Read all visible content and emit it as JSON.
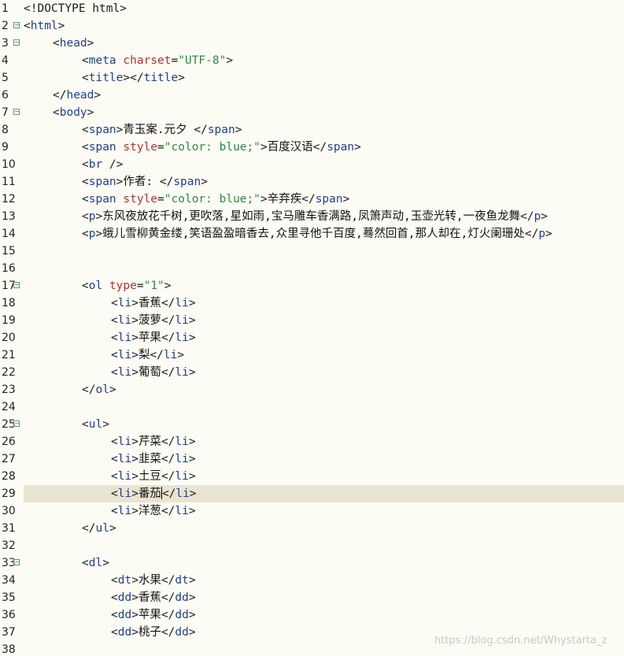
{
  "editor": {
    "lines": [
      {
        "n": "1",
        "fold": false,
        "indent": 0,
        "tokens": [
          [
            "p",
            "<!DOCTYPE html>"
          ]
        ]
      },
      {
        "n": "2",
        "fold": true,
        "indent": 0,
        "tokens": [
          [
            "p",
            "<"
          ],
          [
            "t",
            "html"
          ],
          [
            "p",
            ">"
          ]
        ]
      },
      {
        "n": "3",
        "fold": true,
        "indent": 1,
        "tokens": [
          [
            "p",
            "<"
          ],
          [
            "t",
            "head"
          ],
          [
            "p",
            ">"
          ]
        ]
      },
      {
        "n": "4",
        "fold": false,
        "indent": 2,
        "tokens": [
          [
            "p",
            "<"
          ],
          [
            "t",
            "meta"
          ],
          [
            "p",
            " "
          ],
          [
            "a",
            "charset"
          ],
          [
            "p",
            "="
          ],
          [
            "v",
            "\"UTF-8\""
          ],
          [
            "p",
            ">"
          ]
        ]
      },
      {
        "n": "5",
        "fold": false,
        "indent": 2,
        "tokens": [
          [
            "p",
            "<"
          ],
          [
            "t",
            "title"
          ],
          [
            "p",
            "></"
          ],
          [
            "t",
            "title"
          ],
          [
            "p",
            ">"
          ]
        ]
      },
      {
        "n": "6",
        "fold": false,
        "indent": 1,
        "tokens": [
          [
            "p",
            "</"
          ],
          [
            "t",
            "head"
          ],
          [
            "p",
            ">"
          ]
        ]
      },
      {
        "n": "7",
        "fold": true,
        "indent": 1,
        "tokens": [
          [
            "p",
            "<"
          ],
          [
            "t",
            "body"
          ],
          [
            "p",
            ">"
          ]
        ]
      },
      {
        "n": "8",
        "fold": false,
        "indent": 2,
        "tokens": [
          [
            "p",
            "<"
          ],
          [
            "t",
            "span"
          ],
          [
            "p",
            ">"
          ],
          [
            "tx",
            "青玉案.元夕 "
          ],
          [
            "p",
            "</"
          ],
          [
            "t",
            "span"
          ],
          [
            "p",
            ">"
          ]
        ]
      },
      {
        "n": "9",
        "fold": false,
        "indent": 2,
        "tokens": [
          [
            "p",
            "<"
          ],
          [
            "t",
            "span"
          ],
          [
            "p",
            " "
          ],
          [
            "a",
            "style"
          ],
          [
            "p",
            "="
          ],
          [
            "v",
            "\"color: blue;\""
          ],
          [
            "p",
            ">"
          ],
          [
            "tx",
            "百度汉语"
          ],
          [
            "p",
            "</"
          ],
          [
            "t",
            "span"
          ],
          [
            "p",
            ">"
          ]
        ]
      },
      {
        "n": "10",
        "fold": false,
        "indent": 2,
        "tokens": [
          [
            "p",
            "<"
          ],
          [
            "t",
            "br"
          ],
          [
            "p",
            " />"
          ]
        ]
      },
      {
        "n": "11",
        "fold": false,
        "indent": 2,
        "tokens": [
          [
            "p",
            "<"
          ],
          [
            "t",
            "span"
          ],
          [
            "p",
            ">"
          ],
          [
            "tx",
            "作者: "
          ],
          [
            "p",
            "</"
          ],
          [
            "t",
            "span"
          ],
          [
            "p",
            ">"
          ]
        ]
      },
      {
        "n": "12",
        "fold": false,
        "indent": 2,
        "tokens": [
          [
            "p",
            "<"
          ],
          [
            "t",
            "span"
          ],
          [
            "p",
            " "
          ],
          [
            "a",
            "style"
          ],
          [
            "p",
            "="
          ],
          [
            "v",
            "\"color: blue;\""
          ],
          [
            "p",
            ">"
          ],
          [
            "tx",
            "辛弃疾"
          ],
          [
            "p",
            "</"
          ],
          [
            "t",
            "span"
          ],
          [
            "p",
            ">"
          ]
        ]
      },
      {
        "n": "13",
        "fold": false,
        "indent": 2,
        "tokens": [
          [
            "p",
            "<"
          ],
          [
            "t",
            "p"
          ],
          [
            "p",
            ">"
          ],
          [
            "tx",
            "东风夜放花千树,更吹落,星如雨,宝马雕车香满路,凤箫声动,玉壶光转,一夜鱼龙舞"
          ],
          [
            "p",
            "</"
          ],
          [
            "t",
            "p"
          ],
          [
            "p",
            ">"
          ]
        ]
      },
      {
        "n": "14",
        "fold": false,
        "indent": 2,
        "tokens": [
          [
            "p",
            "<"
          ],
          [
            "t",
            "p"
          ],
          [
            "p",
            ">"
          ],
          [
            "tx",
            "蛾儿雪柳黄金缕,笑语盈盈暗香去,众里寻他千百度,蓦然回首,那人却在,灯火阑珊处"
          ],
          [
            "p",
            "</"
          ],
          [
            "t",
            "p"
          ],
          [
            "p",
            ">"
          ]
        ]
      },
      {
        "n": "15",
        "fold": false,
        "indent": 0,
        "tokens": []
      },
      {
        "n": "16",
        "fold": false,
        "indent": 0,
        "tokens": []
      },
      {
        "n": "17",
        "fold": true,
        "indent": 2,
        "tokens": [
          [
            "p",
            "<"
          ],
          [
            "t",
            "ol"
          ],
          [
            "p",
            " "
          ],
          [
            "a",
            "type"
          ],
          [
            "p",
            "="
          ],
          [
            "v",
            "\"1\""
          ],
          [
            "p",
            ">"
          ]
        ]
      },
      {
        "n": "18",
        "fold": false,
        "indent": 3,
        "tokens": [
          [
            "p",
            "<"
          ],
          [
            "t",
            "li"
          ],
          [
            "p",
            ">"
          ],
          [
            "tx",
            "香蕉"
          ],
          [
            "p",
            "</"
          ],
          [
            "t",
            "li"
          ],
          [
            "p",
            ">"
          ]
        ]
      },
      {
        "n": "19",
        "fold": false,
        "indent": 3,
        "tokens": [
          [
            "p",
            "<"
          ],
          [
            "t",
            "li"
          ],
          [
            "p",
            ">"
          ],
          [
            "tx",
            "菠萝"
          ],
          [
            "p",
            "</"
          ],
          [
            "t",
            "li"
          ],
          [
            "p",
            ">"
          ]
        ]
      },
      {
        "n": "20",
        "fold": false,
        "indent": 3,
        "tokens": [
          [
            "p",
            "<"
          ],
          [
            "t",
            "li"
          ],
          [
            "p",
            ">"
          ],
          [
            "tx",
            "苹果"
          ],
          [
            "p",
            "</"
          ],
          [
            "t",
            "li"
          ],
          [
            "p",
            ">"
          ]
        ]
      },
      {
        "n": "21",
        "fold": false,
        "indent": 3,
        "tokens": [
          [
            "p",
            "<"
          ],
          [
            "t",
            "li"
          ],
          [
            "p",
            ">"
          ],
          [
            "tx",
            "梨"
          ],
          [
            "p",
            "</"
          ],
          [
            "t",
            "li"
          ],
          [
            "p",
            ">"
          ]
        ]
      },
      {
        "n": "22",
        "fold": false,
        "indent": 3,
        "tokens": [
          [
            "p",
            "<"
          ],
          [
            "t",
            "li"
          ],
          [
            "p",
            ">"
          ],
          [
            "tx",
            "葡萄"
          ],
          [
            "p",
            "</"
          ],
          [
            "t",
            "li"
          ],
          [
            "p",
            ">"
          ]
        ]
      },
      {
        "n": "23",
        "fold": false,
        "indent": 2,
        "tokens": [
          [
            "p",
            "</"
          ],
          [
            "t",
            "ol"
          ],
          [
            "p",
            ">"
          ]
        ]
      },
      {
        "n": "24",
        "fold": false,
        "indent": 0,
        "tokens": []
      },
      {
        "n": "25",
        "fold": true,
        "indent": 2,
        "tokens": [
          [
            "p",
            "<"
          ],
          [
            "t",
            "ul"
          ],
          [
            "p",
            ">"
          ]
        ]
      },
      {
        "n": "26",
        "fold": false,
        "indent": 3,
        "tokens": [
          [
            "p",
            "<"
          ],
          [
            "t",
            "li"
          ],
          [
            "p",
            ">"
          ],
          [
            "tx",
            "芹菜"
          ],
          [
            "p",
            "</"
          ],
          [
            "t",
            "li"
          ],
          [
            "p",
            ">"
          ]
        ]
      },
      {
        "n": "27",
        "fold": false,
        "indent": 3,
        "tokens": [
          [
            "p",
            "<"
          ],
          [
            "t",
            "li"
          ],
          [
            "p",
            ">"
          ],
          [
            "tx",
            "韭菜"
          ],
          [
            "p",
            "</"
          ],
          [
            "t",
            "li"
          ],
          [
            "p",
            ">"
          ]
        ]
      },
      {
        "n": "28",
        "fold": false,
        "indent": 3,
        "tokens": [
          [
            "p",
            "<"
          ],
          [
            "t",
            "li"
          ],
          [
            "p",
            ">"
          ],
          [
            "tx",
            "土豆"
          ],
          [
            "p",
            "</"
          ],
          [
            "t",
            "li"
          ],
          [
            "p",
            ">"
          ]
        ]
      },
      {
        "n": "29",
        "fold": false,
        "indent": 3,
        "current": true,
        "tokens": [
          [
            "p",
            "<"
          ],
          [
            "t",
            "li"
          ],
          [
            "p",
            ">"
          ],
          [
            "tx",
            "番茄"
          ],
          [
            "caret",
            ""
          ],
          [
            "p",
            "</"
          ],
          [
            "t",
            "li"
          ],
          [
            "p",
            ">"
          ]
        ]
      },
      {
        "n": "30",
        "fold": false,
        "indent": 3,
        "tokens": [
          [
            "p",
            "<"
          ],
          [
            "t",
            "li"
          ],
          [
            "p",
            ">"
          ],
          [
            "tx",
            "洋葱"
          ],
          [
            "p",
            "</"
          ],
          [
            "t",
            "li"
          ],
          [
            "p",
            ">"
          ]
        ]
      },
      {
        "n": "31",
        "fold": false,
        "indent": 2,
        "tokens": [
          [
            "p",
            "</"
          ],
          [
            "t",
            "ul"
          ],
          [
            "p",
            ">"
          ]
        ]
      },
      {
        "n": "32",
        "fold": false,
        "indent": 0,
        "tokens": []
      },
      {
        "n": "33",
        "fold": true,
        "indent": 2,
        "tokens": [
          [
            "p",
            "<"
          ],
          [
            "t",
            "dl"
          ],
          [
            "p",
            ">"
          ]
        ]
      },
      {
        "n": "34",
        "fold": false,
        "indent": 3,
        "tokens": [
          [
            "p",
            "<"
          ],
          [
            "t",
            "dt"
          ],
          [
            "p",
            ">"
          ],
          [
            "tx",
            "水果"
          ],
          [
            "p",
            "</"
          ],
          [
            "t",
            "dt"
          ],
          [
            "p",
            ">"
          ]
        ]
      },
      {
        "n": "35",
        "fold": false,
        "indent": 3,
        "tokens": [
          [
            "p",
            "<"
          ],
          [
            "t",
            "dd"
          ],
          [
            "p",
            ">"
          ],
          [
            "tx",
            "香蕉"
          ],
          [
            "p",
            "</"
          ],
          [
            "t",
            "dd"
          ],
          [
            "p",
            ">"
          ]
        ]
      },
      {
        "n": "36",
        "fold": false,
        "indent": 3,
        "tokens": [
          [
            "p",
            "<"
          ],
          [
            "t",
            "dd"
          ],
          [
            "p",
            ">"
          ],
          [
            "tx",
            "苹果"
          ],
          [
            "p",
            "</"
          ],
          [
            "t",
            "dd"
          ],
          [
            "p",
            ">"
          ]
        ]
      },
      {
        "n": "37",
        "fold": false,
        "indent": 3,
        "tokens": [
          [
            "p",
            "<"
          ],
          [
            "t",
            "dd"
          ],
          [
            "p",
            ">"
          ],
          [
            "tx",
            "桃子"
          ],
          [
            "p",
            "</"
          ],
          [
            "t",
            "dd"
          ],
          [
            "p",
            ">"
          ]
        ]
      },
      {
        "n": "38",
        "fold": false,
        "indent": 0,
        "tokens": []
      }
    ]
  },
  "watermark": {
    "text": "https://blog.csdn.net/Whystarta_z"
  },
  "colors": {
    "background": "#fcfcf5",
    "tag": "#1f3f8f",
    "attribute": "#b5322f",
    "value": "#2e8b3a",
    "current_line": "#e9e4cf"
  }
}
